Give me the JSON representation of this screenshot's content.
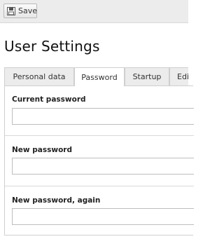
{
  "toolbar": {
    "save_label": "Save"
  },
  "page_title": "User Settings",
  "tabs": [
    {
      "label": "Personal data",
      "active": false
    },
    {
      "label": "Password",
      "active": true
    },
    {
      "label": "Startup",
      "active": false
    },
    {
      "label": "Edi",
      "active": false
    }
  ],
  "fields": [
    {
      "label": "Current password",
      "value": ""
    },
    {
      "label": "New password",
      "value": ""
    },
    {
      "label": "New password, again",
      "value": ""
    }
  ]
}
